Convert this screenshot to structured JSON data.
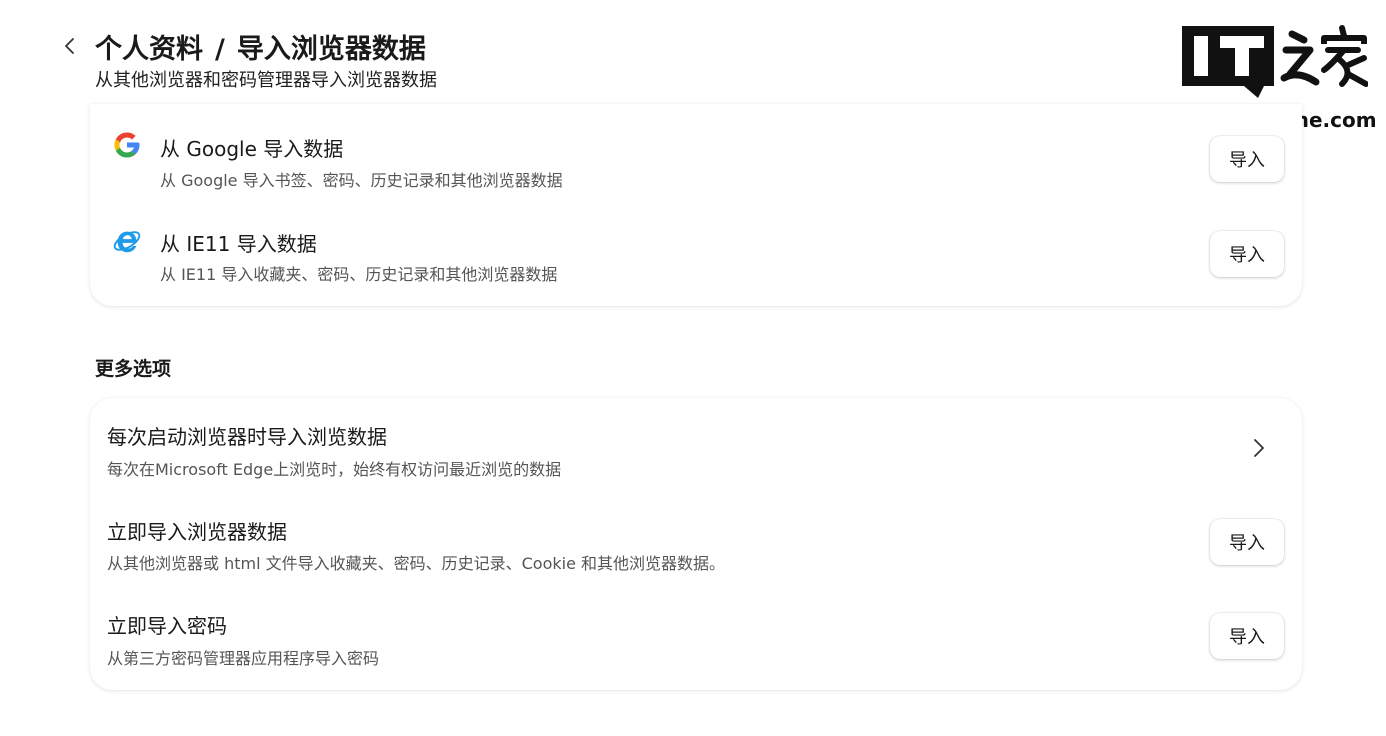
{
  "header": {
    "breadcrumb_parent": "个人资料",
    "breadcrumb_sep": "/",
    "breadcrumb_current": "导入浏览器数据",
    "subtitle": "从其他浏览器和密码管理器导入浏览器数据"
  },
  "watermark": {
    "logo_text": "IT之家",
    "url": "www.ithome.com"
  },
  "browser_sources": [
    {
      "icon": "google-icon",
      "title": "从 Google 导入数据",
      "desc": "从 Google 导入书签、密码、历史记录和其他浏览器数据",
      "button": "导入"
    },
    {
      "icon": "ie-icon",
      "title": "从 IE11 导入数据",
      "desc": "从 IE11 导入收藏夹、密码、历史记录和其他浏览器数据",
      "button": "导入"
    }
  ],
  "more_options": {
    "title": "更多选项",
    "items": [
      {
        "title": "每次启动浏览器时导入浏览数据",
        "desc": "每次在Microsoft Edge上浏览时，始终有权访问最近浏览的数据",
        "action": "chevron-right-icon"
      },
      {
        "title": "立即导入浏览器数据",
        "desc": "从其他浏览器或 html 文件导入收藏夹、密码、历史记录、Cookie 和其他浏览器数据。",
        "button": "导入"
      },
      {
        "title": "立即导入密码",
        "desc": "从第三方密码管理器应用程序导入密码",
        "button": "导入"
      }
    ]
  },
  "colors": {
    "google_blue": "#4285F4",
    "google_red": "#EA4335",
    "google_yellow": "#FBBC05",
    "google_green": "#34A853",
    "ie_blue": "#1E9BE9",
    "text_primary": "#1a1a1a",
    "text_secondary": "#555555"
  }
}
